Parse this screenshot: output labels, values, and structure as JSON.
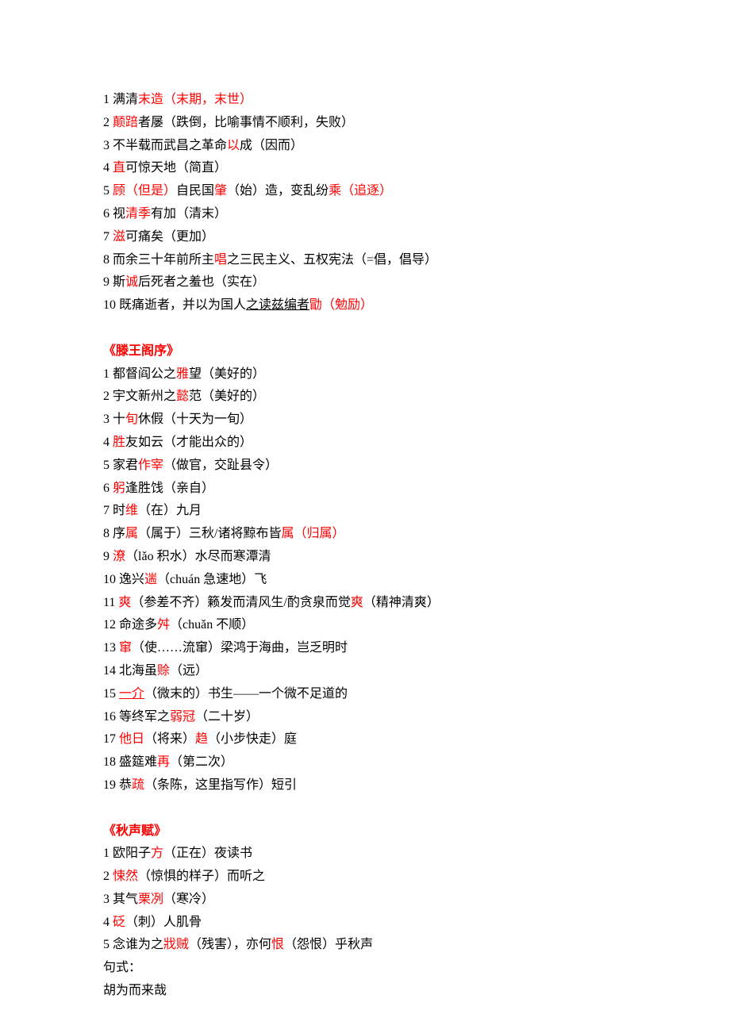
{
  "sections": [
    {
      "lines": [
        [
          {
            "t": "1 满清"
          },
          {
            "t": "末造（末期，末世）",
            "c": "red"
          }
        ],
        [
          {
            "t": "2 "
          },
          {
            "t": "颠踣",
            "c": "red"
          },
          {
            "t": "者屡（跌倒，比喻事情不顺利，失败）"
          }
        ],
        [
          {
            "t": "3 不半载而武昌之革命"
          },
          {
            "t": "以",
            "c": "red"
          },
          {
            "t": "成（因而）"
          }
        ],
        [
          {
            "t": "4 "
          },
          {
            "t": "直",
            "c": "red"
          },
          {
            "t": "可惊天地（简直）"
          }
        ],
        [
          {
            "t": "5 "
          },
          {
            "t": "顾（但是）",
            "c": "red"
          },
          {
            "t": "自民国"
          },
          {
            "t": "肇",
            "c": "red"
          },
          {
            "t": "（始）造，变乱纷"
          },
          {
            "t": "乘（追逐）",
            "c": "red"
          }
        ],
        [
          {
            "t": "6 视"
          },
          {
            "t": "清季",
            "c": "red"
          },
          {
            "t": "有加（清末）"
          }
        ],
        [
          {
            "t": "7 "
          },
          {
            "t": "滋",
            "c": "red"
          },
          {
            "t": "可痛矣（更加）"
          }
        ],
        [
          {
            "t": "8 而余三十年前所主"
          },
          {
            "t": "唱",
            "c": "red"
          },
          {
            "t": "之三民主义、五权宪法（=倡，倡导）"
          }
        ],
        [
          {
            "t": "9 斯"
          },
          {
            "t": "诚",
            "c": "red"
          },
          {
            "t": "后死者之羞也（实在）"
          }
        ],
        [
          {
            "t": "10 既痛逝者，并以为国人"
          },
          {
            "t": "之读兹编者",
            "u": true
          },
          {
            "t": "勖（勉励）",
            "c": "red"
          }
        ]
      ]
    },
    {
      "title": "《滕王阁序》",
      "lines": [
        [
          {
            "t": "1 都督阎公之"
          },
          {
            "t": "雅",
            "c": "red"
          },
          {
            "t": "望（美好的）"
          }
        ],
        [
          {
            "t": "2 宇文新州之"
          },
          {
            "t": "懿",
            "c": "red"
          },
          {
            "t": "范（美好的）"
          }
        ],
        [
          {
            "t": "3 十"
          },
          {
            "t": "旬",
            "c": "red"
          },
          {
            "t": "休假（十天为一旬）"
          }
        ],
        [
          {
            "t": "4 "
          },
          {
            "t": "胜",
            "c": "red"
          },
          {
            "t": "友如云（才能出众的）"
          }
        ],
        [
          {
            "t": "5 家君"
          },
          {
            "t": "作宰",
            "c": "red"
          },
          {
            "t": "（做官，交趾县令）"
          }
        ],
        [
          {
            "t": "6 "
          },
          {
            "t": "躬",
            "c": "red"
          },
          {
            "t": "逢胜饯（亲自）"
          }
        ],
        [
          {
            "t": "7 时"
          },
          {
            "t": "维",
            "c": "red"
          },
          {
            "t": "（在）九月"
          }
        ],
        [
          {
            "t": "8 序"
          },
          {
            "t": "属",
            "c": "red"
          },
          {
            "t": "（属于）三秋/诸将黥布皆"
          },
          {
            "t": "属（归属）",
            "c": "red"
          }
        ],
        [
          {
            "t": "9 "
          },
          {
            "t": "潦",
            "c": "red"
          },
          {
            "t": "（lǎo 积水）水尽而寒潭清"
          }
        ],
        [
          {
            "t": "10 逸兴"
          },
          {
            "t": "遄",
            "c": "red"
          },
          {
            "t": "（chuán 急速地）飞"
          }
        ],
        [
          {
            "t": "11 "
          },
          {
            "t": "爽",
            "c": "red"
          },
          {
            "t": "（参差不齐）籁发而清风生/酌贪泉而觉"
          },
          {
            "t": "爽",
            "c": "red"
          },
          {
            "t": "（精神清爽）"
          }
        ],
        [
          {
            "t": "12 命途多"
          },
          {
            "t": "舛",
            "c": "red"
          },
          {
            "t": "（chuǎn 不顺）"
          }
        ],
        [
          {
            "t": "13 "
          },
          {
            "t": "窜",
            "c": "red"
          },
          {
            "t": "（使……流窜）梁鸿于海曲，岂乏明时"
          }
        ],
        [
          {
            "t": "14 北海虽"
          },
          {
            "t": "赊",
            "c": "red"
          },
          {
            "t": "（远）"
          }
        ],
        [
          {
            "t": "15 "
          },
          {
            "t": "一介",
            "c": "red",
            "u": true
          },
          {
            "t": "（微末的）书生——一个微不足道的"
          }
        ],
        [
          {
            "t": "16 等终军之"
          },
          {
            "t": "弱冠",
            "c": "red"
          },
          {
            "t": "（二十岁）"
          }
        ],
        [
          {
            "t": "17 "
          },
          {
            "t": "他日",
            "c": "red"
          },
          {
            "t": "（将来）"
          },
          {
            "t": "趋",
            "c": "red"
          },
          {
            "t": "（小步快走）庭"
          }
        ],
        [
          {
            "t": "18 盛筵难"
          },
          {
            "t": "再",
            "c": "red"
          },
          {
            "t": "（第二次）"
          }
        ],
        [
          {
            "t": "19 恭"
          },
          {
            "t": "疏",
            "c": "red"
          },
          {
            "t": "（条陈，这里指写作）短引"
          }
        ]
      ]
    },
    {
      "title": "《秋声赋》",
      "lines": [
        [
          {
            "t": "1 欧阳子"
          },
          {
            "t": "方",
            "c": "red"
          },
          {
            "t": "（正在）夜读书"
          }
        ],
        [
          {
            "t": "2 "
          },
          {
            "t": "悚然",
            "c": "red"
          },
          {
            "t": "（惊惧的样子）而听之"
          }
        ],
        [
          {
            "t": "3 其气"
          },
          {
            "t": "栗冽",
            "c": "red"
          },
          {
            "t": "（寒冷）"
          }
        ],
        [
          {
            "t": "4 "
          },
          {
            "t": "砭",
            "c": "red"
          },
          {
            "t": "（刺）人肌骨"
          }
        ],
        [
          {
            "t": "5 念谁为之"
          },
          {
            "t": "戕贼",
            "c": "red"
          },
          {
            "t": "（残害），亦何"
          },
          {
            "t": "恨",
            "c": "red"
          },
          {
            "t": "（怨恨）乎秋声"
          }
        ],
        [
          {
            "t": "句式："
          }
        ],
        [
          {
            "t": "胡为而来哉"
          }
        ]
      ]
    }
  ]
}
